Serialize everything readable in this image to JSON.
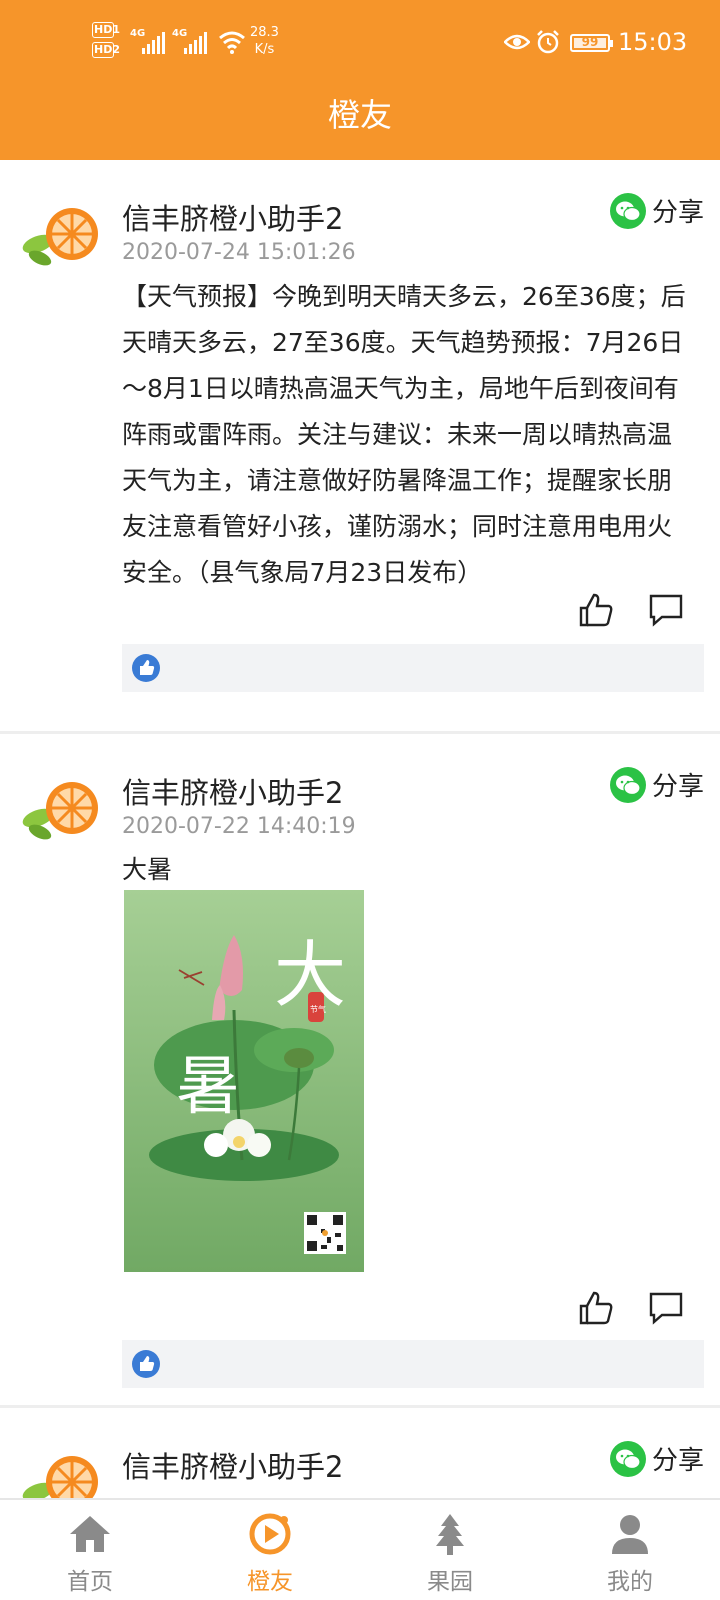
{
  "status_bar": {
    "hd_badges": [
      "HD1",
      "HD2"
    ],
    "networks": [
      "4G",
      "4G"
    ],
    "net_speed_value": "28.3",
    "net_speed_unit": "K/s",
    "battery": "99",
    "time": "15:03"
  },
  "header": {
    "title": "橙友"
  },
  "posts": [
    {
      "author": "信丰脐橙小助手2",
      "share_label": "分享",
      "timestamp": "2020-07-24 15:01:26",
      "content": "【天气预报】今晚到明天晴天多云，26至36度；后天晴天多云，27至36度。天气趋势预报：7月26日～8月1日以晴热高温天气为主，局地午后到夜间有阵雨或雷阵雨。关注与建议：未来一周以晴热高温天气为主，请注意做好防暑降温工作；提醒家长朋友注意看管好小孩，谨防溺水；同时注意用电用火安全。（县气象局7月23日发布）"
    },
    {
      "author": "信丰脐橙小助手2",
      "share_label": "分享",
      "timestamp": "2020-07-22 14:40:19",
      "content": "大暑",
      "poster": {
        "big_chars": [
          "大",
          "暑"
        ],
        "seal": "节气"
      }
    },
    {
      "author": "信丰脐橙小助手2",
      "share_label": "分享"
    }
  ],
  "bottom_nav": [
    {
      "label": "首页",
      "icon": "home-icon",
      "active": false
    },
    {
      "label": "橙友",
      "icon": "orange-play-icon",
      "active": true
    },
    {
      "label": "果园",
      "icon": "tree-icon",
      "active": false
    },
    {
      "label": "我的",
      "icon": "user-icon",
      "active": false
    }
  ],
  "colors": {
    "brand": "#f6952a",
    "wechat": "#2bc245",
    "like": "#3a7bd5"
  }
}
